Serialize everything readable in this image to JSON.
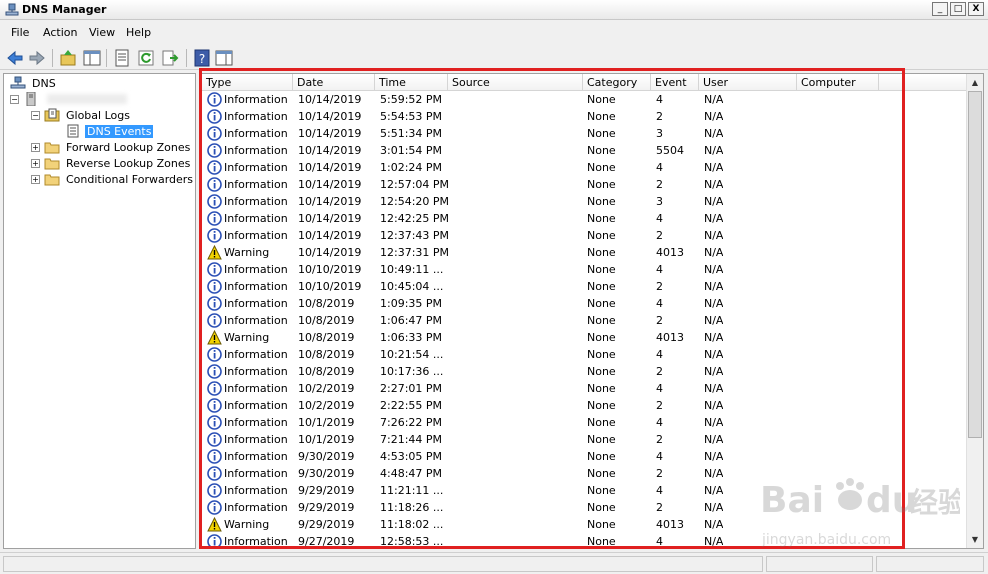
{
  "window": {
    "title": "DNS Manager",
    "minimize": "_",
    "maximize": "□",
    "close": "X"
  },
  "menu": [
    "File",
    "Action",
    "View",
    "Help"
  ],
  "tree": {
    "root": "DNS",
    "server": "",
    "global_logs": "Global Logs",
    "dns_events": "DNS Events",
    "forward": "Forward Lookup Zones",
    "reverse": "Reverse Lookup Zones",
    "conditional": "Conditional Forwarders"
  },
  "columns": [
    "Type",
    "Date",
    "Time",
    "Source",
    "Category",
    "Event",
    "User",
    "Computer"
  ],
  "rows": [
    {
      "type": "Information",
      "date": "10/14/2019",
      "time": "5:59:52 PM",
      "source": "",
      "category": "None",
      "event": "4",
      "user": "N/A"
    },
    {
      "type": "Information",
      "date": "10/14/2019",
      "time": "5:54:53 PM",
      "source": "",
      "category": "None",
      "event": "2",
      "user": "N/A"
    },
    {
      "type": "Information",
      "date": "10/14/2019",
      "time": "5:51:34 PM",
      "source": "",
      "category": "None",
      "event": "3",
      "user": "N/A"
    },
    {
      "type": "Information",
      "date": "10/14/2019",
      "time": "3:01:54 PM",
      "source": "",
      "category": "None",
      "event": "5504",
      "user": "N/A"
    },
    {
      "type": "Information",
      "date": "10/14/2019",
      "time": "1:02:24 PM",
      "source": "",
      "category": "None",
      "event": "4",
      "user": "N/A"
    },
    {
      "type": "Information",
      "date": "10/14/2019",
      "time": "12:57:04 PM",
      "source": "",
      "category": "None",
      "event": "2",
      "user": "N/A"
    },
    {
      "type": "Information",
      "date": "10/14/2019",
      "time": "12:54:20 PM",
      "source": "",
      "category": "None",
      "event": "3",
      "user": "N/A"
    },
    {
      "type": "Information",
      "date": "10/14/2019",
      "time": "12:42:25 PM",
      "source": "",
      "category": "None",
      "event": "4",
      "user": "N/A"
    },
    {
      "type": "Information",
      "date": "10/14/2019",
      "time": "12:37:43 PM",
      "source": "",
      "category": "None",
      "event": "2",
      "user": "N/A"
    },
    {
      "type": "Warning",
      "date": "10/14/2019",
      "time": "12:37:31 PM",
      "source": "",
      "category": "None",
      "event": "4013",
      "user": "N/A"
    },
    {
      "type": "Information",
      "date": "10/10/2019",
      "time": "10:49:11 ...",
      "source": "",
      "category": "None",
      "event": "4",
      "user": "N/A"
    },
    {
      "type": "Information",
      "date": "10/10/2019",
      "time": "10:45:04 ...",
      "source": "",
      "category": "None",
      "event": "2",
      "user": "N/A"
    },
    {
      "type": "Information",
      "date": "10/8/2019",
      "time": "1:09:35 PM",
      "source": "",
      "category": "None",
      "event": "4",
      "user": "N/A"
    },
    {
      "type": "Information",
      "date": "10/8/2019",
      "time": "1:06:47 PM",
      "source": "",
      "category": "None",
      "event": "2",
      "user": "N/A"
    },
    {
      "type": "Warning",
      "date": "10/8/2019",
      "time": "1:06:33 PM",
      "source": "",
      "category": "None",
      "event": "4013",
      "user": "N/A"
    },
    {
      "type": "Information",
      "date": "10/8/2019",
      "time": "10:21:54 ...",
      "source": "",
      "category": "None",
      "event": "4",
      "user": "N/A"
    },
    {
      "type": "Information",
      "date": "10/8/2019",
      "time": "10:17:36 ...",
      "source": "",
      "category": "None",
      "event": "2",
      "user": "N/A"
    },
    {
      "type": "Information",
      "date": "10/2/2019",
      "time": "2:27:01 PM",
      "source": "",
      "category": "None",
      "event": "4",
      "user": "N/A"
    },
    {
      "type": "Information",
      "date": "10/2/2019",
      "time": "2:22:55 PM",
      "source": "",
      "category": "None",
      "event": "2",
      "user": "N/A"
    },
    {
      "type": "Information",
      "date": "10/1/2019",
      "time": "7:26:22 PM",
      "source": "",
      "category": "None",
      "event": "4",
      "user": "N/A"
    },
    {
      "type": "Information",
      "date": "10/1/2019",
      "time": "7:21:44 PM",
      "source": "",
      "category": "None",
      "event": "2",
      "user": "N/A"
    },
    {
      "type": "Information",
      "date": "9/30/2019",
      "time": "4:53:05 PM",
      "source": "",
      "category": "None",
      "event": "4",
      "user": "N/A"
    },
    {
      "type": "Information",
      "date": "9/30/2019",
      "time": "4:48:47 PM",
      "source": "",
      "category": "None",
      "event": "2",
      "user": "N/A"
    },
    {
      "type": "Information",
      "date": "9/29/2019",
      "time": "11:21:11 ...",
      "source": "",
      "category": "None",
      "event": "4",
      "user": "N/A"
    },
    {
      "type": "Information",
      "date": "9/29/2019",
      "time": "11:18:26 ...",
      "source": "",
      "category": "None",
      "event": "2",
      "user": "N/A"
    },
    {
      "type": "Warning",
      "date": "9/29/2019",
      "time": "11:18:02 ...",
      "source": "",
      "category": "None",
      "event": "4013",
      "user": "N/A"
    },
    {
      "type": "Information",
      "date": "9/27/2019",
      "time": "12:58:53 ...",
      "source": "",
      "category": "None",
      "event": "4",
      "user": "N/A"
    }
  ],
  "watermark": {
    "brand": "Bai",
    "brand2": "du",
    "suffix": "经验",
    "url": "jingyan.baidu.com"
  },
  "colors": {
    "highlight": "#e02020",
    "selection": "#3399ff",
    "info_icon": "#2a4fb5",
    "warning_icon": "#f2d300"
  }
}
